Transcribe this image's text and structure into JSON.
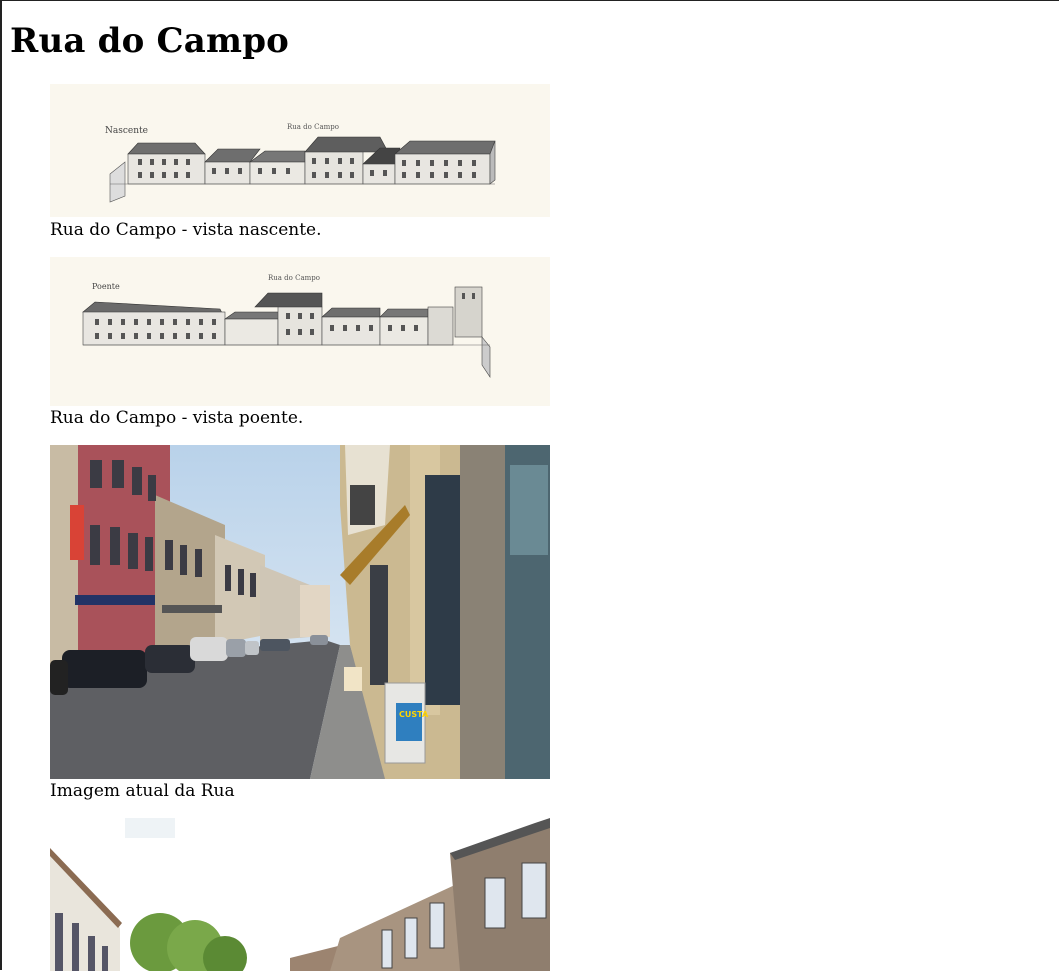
{
  "page": {
    "title": "Rua do Campo"
  },
  "figures": [
    {
      "caption": "Rua do Campo - vista nascente.",
      "labels": {
        "left": "Nascente",
        "center": "Rua do Campo"
      }
    },
    {
      "caption": "Rua do Campo - vista poente.",
      "labels": {
        "left": "Poente",
        "center": "Rua do Campo"
      }
    },
    {
      "caption": "Imagem atual da Rua",
      "labels": {
        "sign": "CUSTA"
      }
    },
    {
      "caption": ""
    }
  ]
}
